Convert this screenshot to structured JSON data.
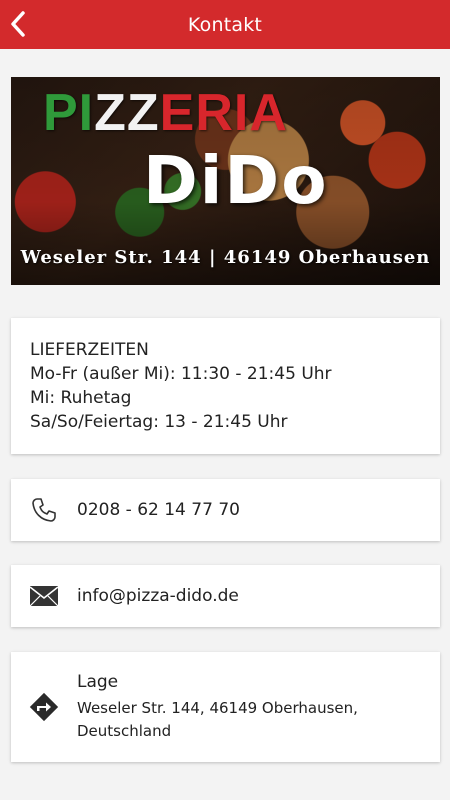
{
  "header": {
    "title": "Kontakt",
    "back_icon": "chevron-left-icon",
    "color": "#d32a2c"
  },
  "banner": {
    "brand_part1": "PIZZ",
    "brand_part2": "ERIA",
    "brand_part1_green": "PI",
    "brand_part1_white": "ZZ",
    "brand_name": "DiDo",
    "address_line": "Weseler Str. 144 | 46149 Oberhausen"
  },
  "hours": {
    "heading": "LIEFERZEITEN",
    "line1": "Mo-Fr (außer Mi): 11:30 - 21:45 Uhr",
    "line2": "Mi: Ruhetag",
    "line3": "Sa/So/Feiertag: 13 - 21:45 Uhr"
  },
  "phone": {
    "icon": "phone-icon",
    "number": "0208 - 62 14 77 70"
  },
  "email": {
    "icon": "envelope-icon",
    "address": "info@pizza-dido.de"
  },
  "location": {
    "icon": "directions-icon",
    "label": "Lage",
    "address": "Weseler Str. 144, 46149 Oberhausen, Deutschland"
  }
}
